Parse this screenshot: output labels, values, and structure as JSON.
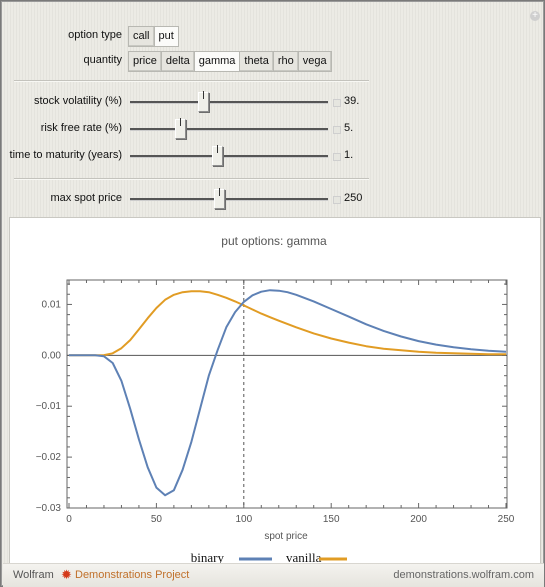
{
  "controls": {
    "option_type": {
      "label": "option type",
      "options": [
        "call",
        "put"
      ],
      "selected": "put"
    },
    "quantity": {
      "label": "quantity",
      "options": [
        "price",
        "delta",
        "gamma",
        "theta",
        "rho",
        "vega"
      ],
      "selected": "gamma"
    },
    "sliders": [
      {
        "label": "stock volatility (%)",
        "value_text": "39.",
        "fraction": 0.37
      },
      {
        "label": "risk free rate (%)",
        "value_text": "5.",
        "fraction": 0.25
      },
      {
        "label": "time to maturity (years)",
        "value_text": "1.",
        "fraction": 0.44
      }
    ],
    "max_spot": {
      "label": "max spot price",
      "value_text": "250",
      "fraction": 0.45
    }
  },
  "footer": {
    "wolfram": "Wolfram",
    "project": "Demonstrations Project",
    "site": "demonstrations.wolfram.com"
  },
  "colors": {
    "binary": "#5e81b5",
    "vanilla": "#e19c24",
    "axis": "#555555"
  },
  "chart_data": {
    "type": "line",
    "title": "put options: gamma",
    "xlabel": "spot price",
    "ylabel": "",
    "xlim": [
      0,
      250
    ],
    "ylim": [
      -0.03,
      0.0148
    ],
    "xticks": [
      0,
      50,
      100,
      150,
      200,
      250
    ],
    "xtick_labels": [
      "0",
      "50",
      "100",
      "150",
      "200",
      "250"
    ],
    "yticks": [
      0.01,
      0.0,
      -0.01,
      -0.02,
      -0.03
    ],
    "ytick_labels": [
      "0.01",
      "0.00",
      "-0.01",
      "-0.02",
      "-0.03"
    ],
    "vline": 100,
    "grid": false,
    "legend_position": "bottom",
    "series": [
      {
        "name": "binary",
        "x": [
          0,
          10,
          15,
          20,
          25,
          30,
          35,
          40,
          45,
          50,
          55,
          60,
          65,
          70,
          75,
          80,
          85,
          90,
          95,
          100,
          105,
          110,
          115,
          120,
          125,
          130,
          140,
          150,
          160,
          170,
          180,
          190,
          200,
          210,
          220,
          230,
          240,
          250
        ],
        "y": [
          0,
          0,
          0,
          -0.0002,
          -0.0015,
          -0.005,
          -0.0105,
          -0.0165,
          -0.022,
          -0.026,
          -0.0275,
          -0.0265,
          -0.0225,
          -0.017,
          -0.0105,
          -0.004,
          0.001,
          0.0055,
          0.0085,
          0.0105,
          0.0118,
          0.0125,
          0.0128,
          0.0127,
          0.0124,
          0.0119,
          0.0106,
          0.0091,
          0.0076,
          0.0061,
          0.0048,
          0.0037,
          0.0028,
          0.0021,
          0.0016,
          0.0012,
          0.0009,
          0.0007
        ]
      },
      {
        "name": "vanilla",
        "x": [
          0,
          10,
          15,
          20,
          25,
          30,
          35,
          40,
          45,
          50,
          55,
          60,
          65,
          70,
          75,
          80,
          85,
          90,
          95,
          100,
          105,
          110,
          115,
          120,
          130,
          140,
          150,
          160,
          170,
          180,
          190,
          200,
          210,
          220,
          230,
          240,
          250
        ],
        "y": [
          0,
          0,
          0,
          5e-05,
          0.0004,
          0.0014,
          0.003,
          0.0051,
          0.0073,
          0.0093,
          0.0109,
          0.0119,
          0.0124,
          0.0126,
          0.0126,
          0.0124,
          0.0119,
          0.0113,
          0.0106,
          0.0098,
          0.009,
          0.0082,
          0.0075,
          0.0068,
          0.0055,
          0.0043,
          0.0033,
          0.0025,
          0.0018,
          0.0013,
          0.001,
          0.0007,
          0.0005,
          0.0004,
          0.0003,
          0.0002,
          0.0002
        ]
      }
    ]
  }
}
